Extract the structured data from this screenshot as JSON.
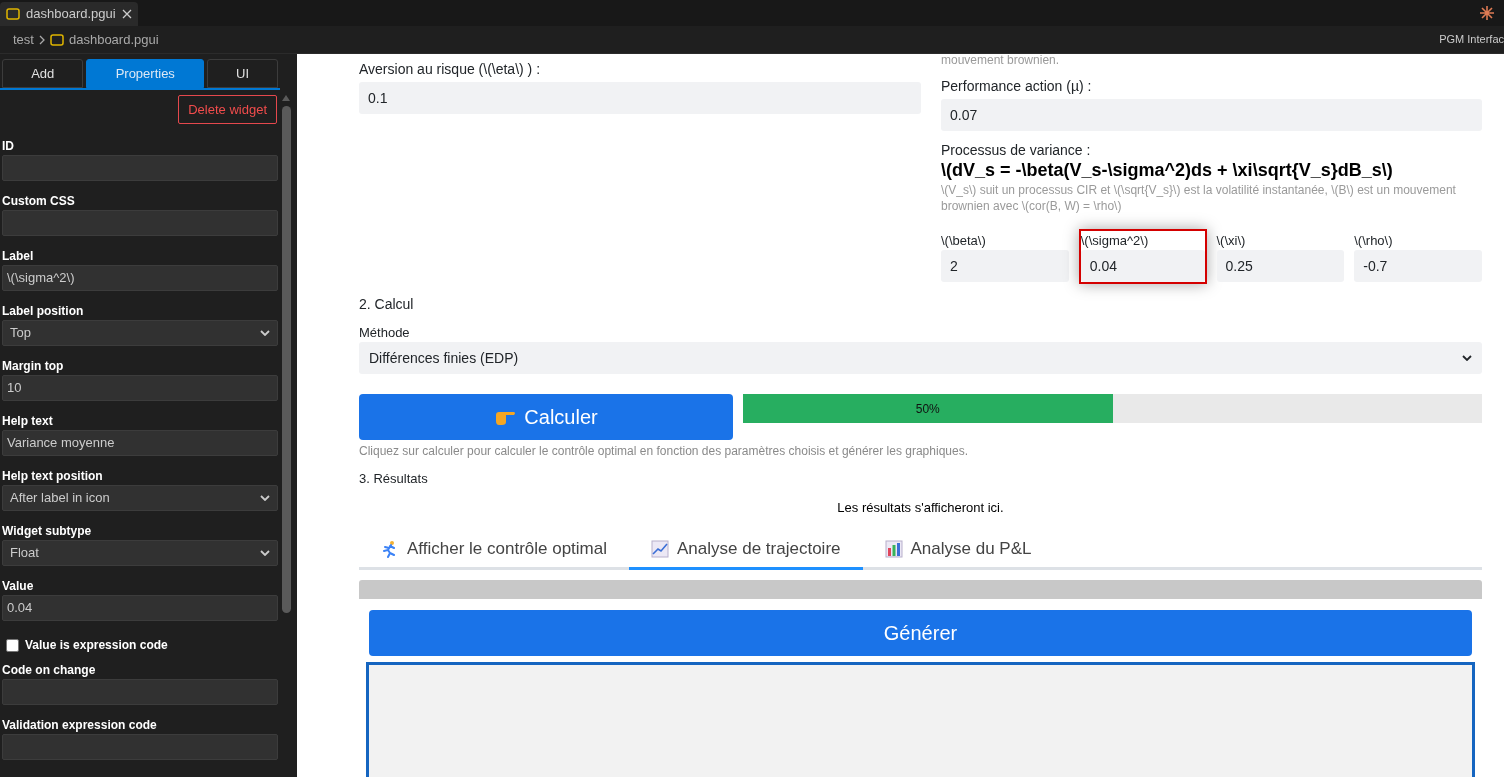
{
  "editor_tab": {
    "title": "dashboard.pgui",
    "selected": true
  },
  "breadcrumb": [
    "test",
    "dashboard.pgui"
  ],
  "status_label": "PGM Interfac",
  "panel_tabs": [
    {
      "label": "Add",
      "selected": false
    },
    {
      "label": "Properties",
      "selected": true
    },
    {
      "label": "UI",
      "selected": false
    }
  ],
  "delete_button": "Delete widget",
  "properties": [
    {
      "kind": "text",
      "label": "ID"
    },
    {
      "kind": "text",
      "label": "Custom CSS"
    },
    {
      "kind": "text",
      "label": "Label",
      "value": "\\(\\sigma^2\\)"
    },
    {
      "kind": "select",
      "label": "Label position",
      "value": "Top"
    },
    {
      "kind": "text",
      "label": "Margin top",
      "value": "10"
    },
    {
      "kind": "text",
      "label": "Help text",
      "value": "Variance moyenne"
    },
    {
      "kind": "select",
      "label": "Help text position",
      "value": "After label in icon"
    },
    {
      "kind": "select",
      "label": "Widget subtype",
      "value": "Float"
    },
    {
      "kind": "text",
      "label": "Value",
      "value": "0.04"
    },
    {
      "kind": "checkbox",
      "label": "Value is expression code",
      "checked": false
    },
    {
      "kind": "text",
      "label": "Code on change"
    },
    {
      "kind": "text",
      "label": "Validation expression code"
    }
  ],
  "form": {
    "note_top": "mouvement brownien.",
    "risk": {
      "label": "Aversion au risque (\\(\\eta\\) ) :",
      "value": "0.1"
    },
    "performance": {
      "label": "Performance action (µ) :",
      "value": "0.07"
    },
    "variance": {
      "label": "Processus de variance :",
      "formula": "\\(dV_s = -\\beta(V_s-\\sigma^2)ds + \\xi\\sqrt{V_s}dB_s\\)",
      "help": "\\(V_s\\) suit un processus CIR et \\(\\sqrt{V_s}\\) est la volatilité instantanée, \\(B\\) est un mouvement brownien avec \\(cor(B, W) = \\rho\\)"
    },
    "params": [
      {
        "label": "\\(\\beta\\)",
        "value": "2",
        "selected": false
      },
      {
        "label": "\\(\\sigma^2\\)",
        "value": "0.04",
        "selected": true
      },
      {
        "label": "\\(\\xi\\)",
        "value": "0.25",
        "selected": false
      },
      {
        "label": "\\(\\rho\\)",
        "value": "-0.7",
        "selected": false
      }
    ]
  },
  "calc": {
    "heading": "2. Calcul",
    "method_label": "Méthode",
    "method": "Différences finies (EDP)",
    "button": "Calculer",
    "progress": {
      "level": 0.5,
      "reading": "50%"
    },
    "help": "Cliquez sur calculer pour calculer le contrôle optimal en fonction des paramètres choisis et générer les graphiques."
  },
  "results": {
    "heading": "3. Résultats",
    "message": "Les résultats s'afficheront ici.",
    "tabs": [
      {
        "kind": "runner",
        "label": "Afficher le contrôle optimal",
        "selected": false
      },
      {
        "kind": "line",
        "label": "Analyse de trajectoire",
        "selected": true
      },
      {
        "kind": "bars",
        "label": "Analyse du P&L",
        "selected": false
      }
    ],
    "generate_button": "Générer"
  }
}
